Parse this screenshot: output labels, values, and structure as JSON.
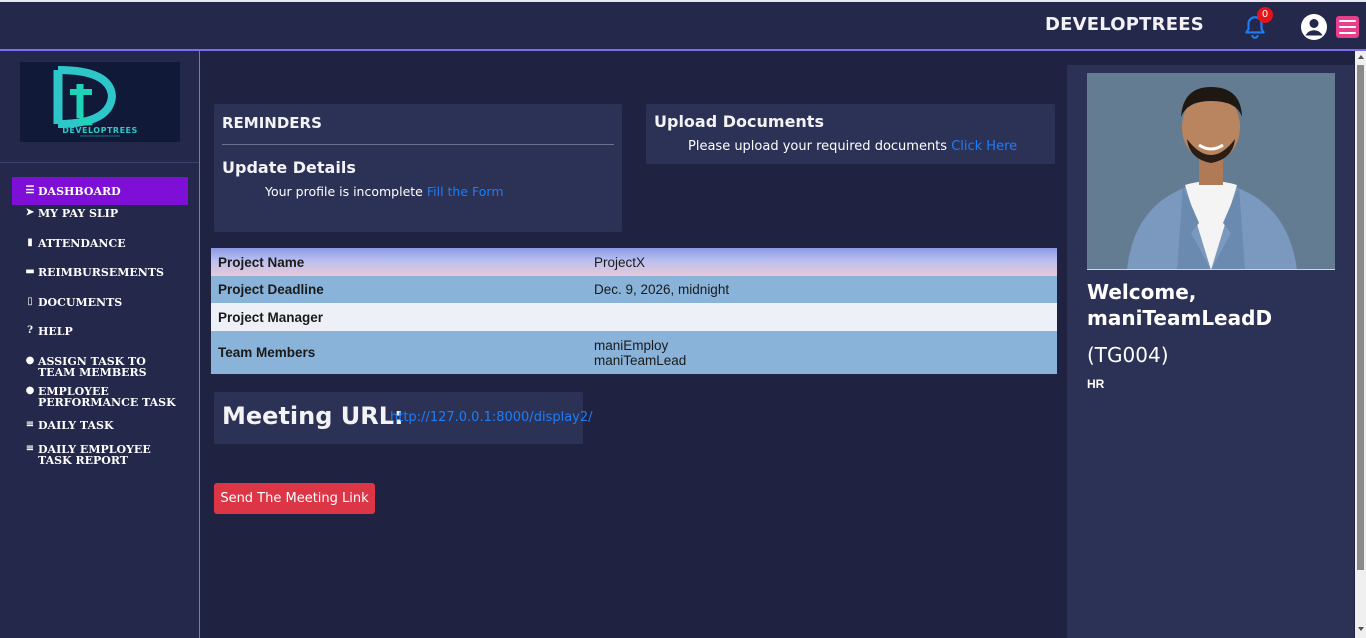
{
  "header": {
    "brand": "DEVELOPTREES",
    "notification_count": "0",
    "colors": {
      "bell": "#1e7df5",
      "badge": "#e3141a",
      "menu": "#e83e8c"
    }
  },
  "sidebar": {
    "logo_text": "DEVELOPTREES",
    "items": [
      {
        "icon": "list-icon",
        "label": "DASHBOARD",
        "active": true
      },
      {
        "icon": "paper-plane-icon",
        "label": "MY PAY SLIP"
      },
      {
        "icon": "calendar-icon",
        "label": "ATTENDANCE"
      },
      {
        "icon": "credit-card-icon",
        "label": "REIMBURSEMENTS"
      },
      {
        "icon": "file-icon",
        "label": "DOCUMENTS"
      },
      {
        "icon": "question-circle-icon",
        "label": "HELP"
      },
      {
        "icon": "users-icon",
        "label": "ASSIGN TASK TO TEAM MEMBERS"
      },
      {
        "icon": "user-edit-icon",
        "label": "EMPLOYEE PERFORMANCE TASK"
      },
      {
        "icon": "tasks-icon",
        "label": "DAILY TASK"
      },
      {
        "icon": "tasks-icon",
        "label": "DAILY EMPLOYEE TASK REPORT"
      }
    ],
    "active_color": "#7d0fd6"
  },
  "reminders": {
    "title": "REMINDERS",
    "subtitle": "Update Details",
    "message": "Your profile is incomplete",
    "link": "Fill the Form"
  },
  "upload": {
    "title": "Upload Documents",
    "message": "Please upload your required documents",
    "link": "Click Here"
  },
  "project": {
    "rows": [
      {
        "label": "Project Name",
        "value": "ProjectX"
      },
      {
        "label": "Project Deadline",
        "value": "Dec. 9, 2026, midnight"
      },
      {
        "label": "Project Manager",
        "value": ""
      },
      {
        "label": "Team Members",
        "values": [
          "maniEmploy",
          "maniTeamLead"
        ]
      }
    ]
  },
  "meeting": {
    "label": "Meeting URL:",
    "url": "http://127.0.0.1:8000/display2/",
    "send_button": "Send The Meeting Link"
  },
  "profile": {
    "welcome": "Welcome,",
    "name": "maniTeamLeadD",
    "emp_id": "(TG004)",
    "role": "HR"
  }
}
